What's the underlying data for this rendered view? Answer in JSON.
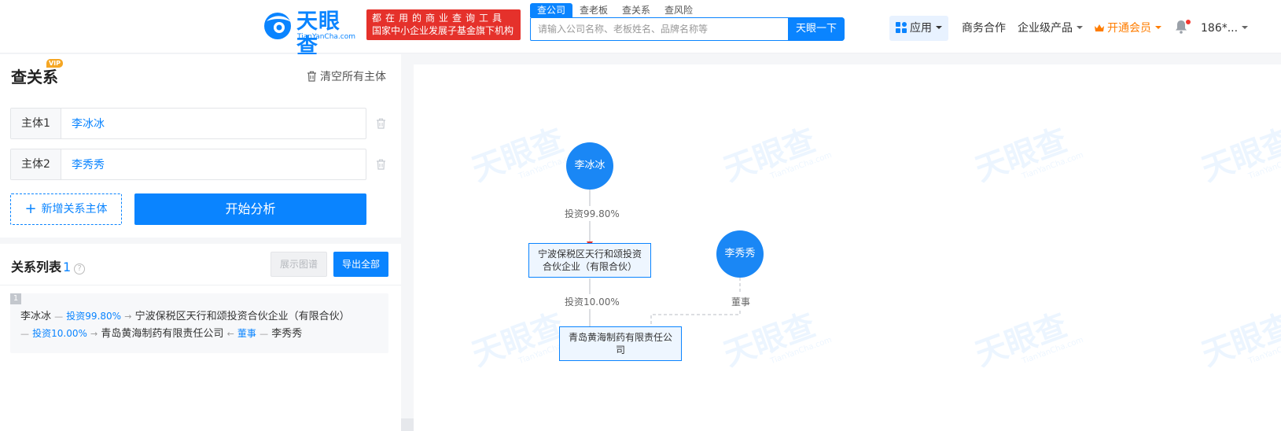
{
  "header": {
    "logo": {
      "brand": "天眼查",
      "domain": "TianYanCha.com"
    },
    "slogan": {
      "line1": "都在用的商业查询工具",
      "line2": "国家中小企业发展子基金旗下机构"
    },
    "search_tabs": [
      "查公司",
      "查老板",
      "查关系",
      "查风险"
    ],
    "search": {
      "placeholder": "请输入公司名称、老板姓名、品牌名称等",
      "button": "天眼一下"
    },
    "nav": {
      "app": "应用",
      "biz": "商务合作",
      "enterprise": "企业级产品",
      "vip": "开通会员",
      "user": "186*..."
    }
  },
  "sidebar": {
    "title": "查关系",
    "vip_badge": "VIP",
    "clear_all": "清空所有主体",
    "entities": [
      {
        "label": "主体1",
        "value": "李冰冰"
      },
      {
        "label": "主体2",
        "value": "李秀秀"
      }
    ],
    "add_entity": "新增关系主体",
    "analyze": "开始分析"
  },
  "relations": {
    "title": "关系列表",
    "count": "1",
    "show_graph": "展示图谱",
    "export_all": "导出全部",
    "items": [
      {
        "index": "1",
        "p1": "李冰冰",
        "e1": "投资99.80%",
        "c1": "宁波保税区天行和颂投资合伙企业（有限合伙）",
        "e2": "投资10.00%",
        "c2": "青岛黄海制药有限责任公司",
        "e3": "董事",
        "p2": "李秀秀"
      }
    ]
  },
  "graph": {
    "watermark_text": "天眼查",
    "watermark_sub": "TianYanCha.com",
    "nodes": {
      "person1": "李冰冰",
      "person2": "李秀秀",
      "company1": "宁波保税区天行和颂投资合伙企业（有限合伙）",
      "company2": "青岛黄海制药有限责任公司"
    },
    "edges": {
      "e1": "投资99.80%",
      "e2": "投资10.00%",
      "e3": "董事"
    },
    "colors": {
      "person": "#1a87f5",
      "invest_arrow": "#e5312b",
      "director_arrow": "#0a84ff",
      "line": "#b8bcc4"
    }
  }
}
